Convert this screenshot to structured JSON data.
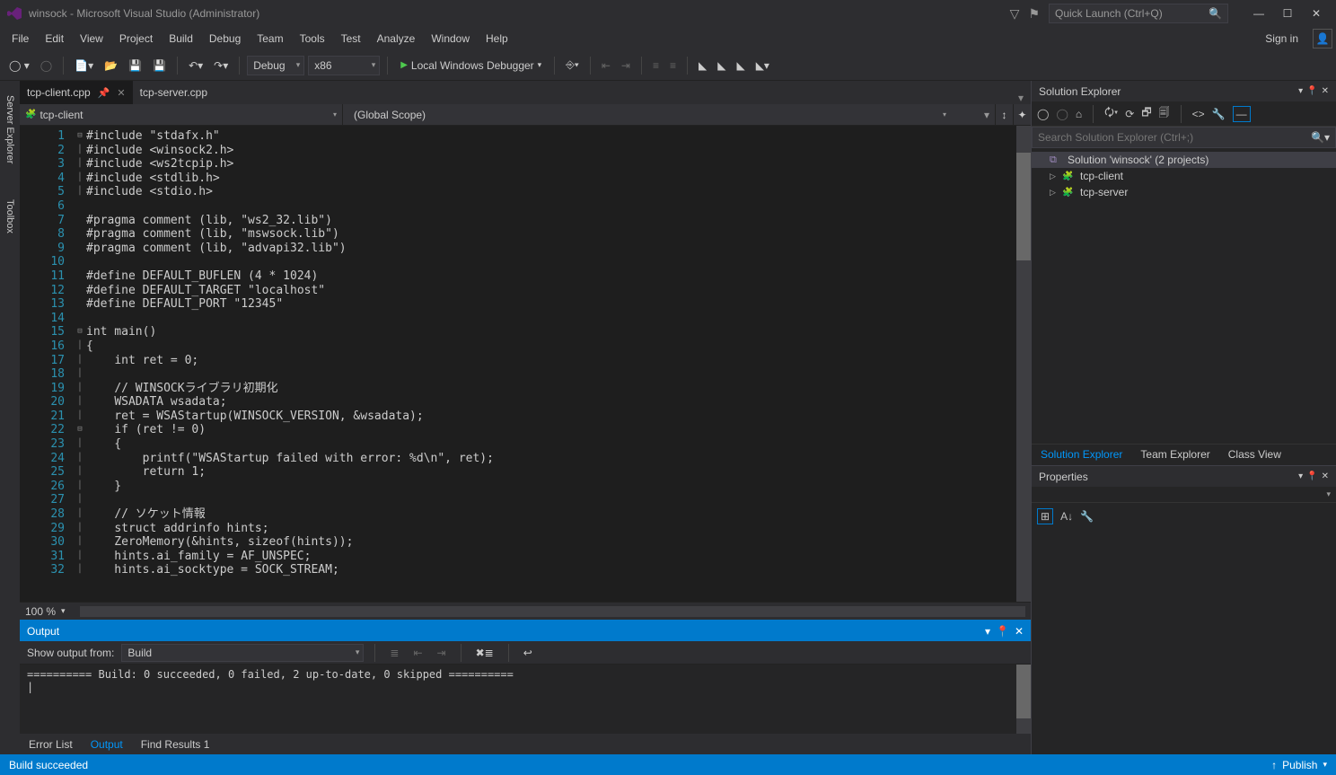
{
  "titlebar": {
    "app_logo_color": "#68217a",
    "title": "winsock - Microsoft Visual Studio  (Administrator)",
    "quick_launch_placeholder": "Quick Launch (Ctrl+Q)"
  },
  "menu": {
    "items": [
      "File",
      "Edit",
      "View",
      "Project",
      "Build",
      "Debug",
      "Team",
      "Tools",
      "Test",
      "Analyze",
      "Window",
      "Help"
    ],
    "signin": "Sign in"
  },
  "toolbar": {
    "config": "Debug",
    "platform": "x86",
    "debugger": "Local Windows Debugger"
  },
  "left_sidebar": {
    "tabs": [
      "Server Explorer",
      "Toolbox"
    ]
  },
  "tabs": [
    {
      "label": "tcp-client.cpp",
      "active": true,
      "pinned": true
    },
    {
      "label": "tcp-server.cpp",
      "active": false,
      "pinned": false
    }
  ],
  "nav": {
    "left_icon": "cpp",
    "left": "tcp-client",
    "right": "(Global Scope)"
  },
  "code": {
    "lines": [
      {
        "n": 1,
        "fold": "⊟",
        "tokens": [
          {
            "t": "#include ",
            "c": "mac"
          },
          {
            "t": "\"stdafx.h\"",
            "c": "str"
          }
        ],
        "bar": true
      },
      {
        "n": 2,
        "tokens": [
          {
            "t": "#include ",
            "c": "mac"
          },
          {
            "t": "<winsock2.h>",
            "c": "str"
          }
        ],
        "bar": true
      },
      {
        "n": 3,
        "tokens": [
          {
            "t": "#include ",
            "c": "mac"
          },
          {
            "t": "<ws2tcpip.h>",
            "c": "str"
          }
        ],
        "bar": true
      },
      {
        "n": 4,
        "tokens": [
          {
            "t": "#include ",
            "c": "mac"
          },
          {
            "t": "<stdlib.h>",
            "c": "str"
          }
        ],
        "bar": true
      },
      {
        "n": 5,
        "tokens": [
          {
            "t": "#include ",
            "c": "mac"
          },
          {
            "t": "<stdio.h>",
            "c": "str"
          }
        ],
        "bar": true
      },
      {
        "n": 6,
        "tokens": []
      },
      {
        "n": 7,
        "tokens": [
          {
            "t": "#pragma ",
            "c": "mac"
          },
          {
            "t": "comment ",
            "c": "mac"
          },
          {
            "t": "(lib, ",
            "c": "id"
          },
          {
            "t": "\"ws2_32.lib\"",
            "c": "str"
          },
          {
            "t": ")",
            "c": "id"
          }
        ]
      },
      {
        "n": 8,
        "tokens": [
          {
            "t": "#pragma ",
            "c": "mac"
          },
          {
            "t": "comment ",
            "c": "mac"
          },
          {
            "t": "(lib, ",
            "c": "id"
          },
          {
            "t": "\"mswsock.lib\"",
            "c": "str"
          },
          {
            "t": ")",
            "c": "id"
          }
        ]
      },
      {
        "n": 9,
        "tokens": [
          {
            "t": "#pragma ",
            "c": "mac"
          },
          {
            "t": "comment ",
            "c": "mac"
          },
          {
            "t": "(lib, ",
            "c": "id"
          },
          {
            "t": "\"advapi32.lib\"",
            "c": "str"
          },
          {
            "t": ")",
            "c": "id"
          }
        ]
      },
      {
        "n": 10,
        "tokens": []
      },
      {
        "n": 11,
        "tokens": [
          {
            "t": "#define ",
            "c": "mac"
          },
          {
            "t": "DEFAULT_BUFLEN",
            "c": "def"
          },
          {
            "t": " (",
            "c": "id"
          },
          {
            "t": "4",
            "c": "num"
          },
          {
            "t": " * ",
            "c": "id"
          },
          {
            "t": "1024",
            "c": "num"
          },
          {
            "t": ")",
            "c": "id"
          }
        ]
      },
      {
        "n": 12,
        "tokens": [
          {
            "t": "#define ",
            "c": "mac"
          },
          {
            "t": "DEFAULT_TARGET",
            "c": "def"
          },
          {
            "t": " ",
            "c": "id"
          },
          {
            "t": "\"localhost\"",
            "c": "str"
          }
        ]
      },
      {
        "n": 13,
        "tokens": [
          {
            "t": "#define ",
            "c": "mac"
          },
          {
            "t": "DEFAULT_PORT",
            "c": "def"
          },
          {
            "t": " ",
            "c": "id"
          },
          {
            "t": "\"12345\"",
            "c": "str"
          }
        ]
      },
      {
        "n": 14,
        "tokens": []
      },
      {
        "n": 15,
        "fold": "⊟",
        "tokens": [
          {
            "t": "int",
            "c": "kw"
          },
          {
            "t": " main()",
            "c": "id"
          }
        ]
      },
      {
        "n": 16,
        "tokens": [
          {
            "t": "{",
            "c": "id"
          }
        ],
        "bar": true
      },
      {
        "n": 17,
        "tokens": [
          {
            "t": "    ",
            "c": "id"
          },
          {
            "t": "int",
            "c": "kw"
          },
          {
            "t": " ret = ",
            "c": "id"
          },
          {
            "t": "0",
            "c": "num"
          },
          {
            "t": ";",
            "c": "id"
          }
        ],
        "bar": true
      },
      {
        "n": 18,
        "tokens": [],
        "bar": true
      },
      {
        "n": 19,
        "tokens": [
          {
            "t": "    ",
            "c": "id"
          },
          {
            "t": "// WINSOCKライブラリ初期化",
            "c": "cm"
          }
        ],
        "bar": true
      },
      {
        "n": 20,
        "tokens": [
          {
            "t": "    ",
            "c": "id"
          },
          {
            "t": "WSADATA",
            "c": "def2"
          },
          {
            "t": " wsadata;",
            "c": "id"
          }
        ],
        "bar": true
      },
      {
        "n": 21,
        "tokens": [
          {
            "t": "    ret = WSAStartup(",
            "c": "id"
          },
          {
            "t": "WINSOCK_VERSION",
            "c": "def"
          },
          {
            "t": ", &wsadata);",
            "c": "id"
          }
        ],
        "bar": true
      },
      {
        "n": 22,
        "fold": "⊟",
        "tokens": [
          {
            "t": "    ",
            "c": "id"
          },
          {
            "t": "if",
            "c": "kw"
          },
          {
            "t": " (ret != ",
            "c": "id"
          },
          {
            "t": "0",
            "c": "num"
          },
          {
            "t": ")",
            "c": "id"
          }
        ],
        "bar": true
      },
      {
        "n": 23,
        "tokens": [
          {
            "t": "    {",
            "c": "id"
          }
        ],
        "bar": true
      },
      {
        "n": 24,
        "tokens": [
          {
            "t": "        printf(",
            "c": "id"
          },
          {
            "t": "\"WSAStartup failed with error: %d\\n\"",
            "c": "str"
          },
          {
            "t": ", ret);",
            "c": "id"
          }
        ],
        "bar": true
      },
      {
        "n": 25,
        "tokens": [
          {
            "t": "        ",
            "c": "id"
          },
          {
            "t": "return",
            "c": "kw"
          },
          {
            "t": " ",
            "c": "id"
          },
          {
            "t": "1",
            "c": "num"
          },
          {
            "t": ";",
            "c": "id"
          }
        ],
        "bar": true
      },
      {
        "n": 26,
        "tokens": [
          {
            "t": "    }",
            "c": "id"
          }
        ],
        "bar": true
      },
      {
        "n": 27,
        "tokens": [],
        "bar": true
      },
      {
        "n": 28,
        "tokens": [
          {
            "t": "    ",
            "c": "id"
          },
          {
            "t": "// ソケット情報",
            "c": "cm"
          }
        ],
        "bar": true
      },
      {
        "n": 29,
        "tokens": [
          {
            "t": "    ",
            "c": "id"
          },
          {
            "t": "struct",
            "c": "kw"
          },
          {
            "t": " ",
            "c": "id"
          },
          {
            "t": "addrinfo",
            "c": "ty"
          },
          {
            "t": " hints;",
            "c": "id"
          }
        ],
        "bar": true
      },
      {
        "n": 30,
        "tokens": [
          {
            "t": "    ZeroMemory",
            "c": "def"
          },
          {
            "t": "(&hints, ",
            "c": "id"
          },
          {
            "t": "sizeof",
            "c": "kw"
          },
          {
            "t": "(hints));",
            "c": "id"
          }
        ],
        "bar": true
      },
      {
        "n": 31,
        "tokens": [
          {
            "t": "    hints.ai_family = ",
            "c": "id"
          },
          {
            "t": "AF_UNSPEC",
            "c": "def"
          },
          {
            "t": ";",
            "c": "id"
          }
        ],
        "bar": true
      },
      {
        "n": 32,
        "tokens": [
          {
            "t": "    hints.ai_socktype = ",
            "c": "id"
          },
          {
            "t": "SOCK_STREAM",
            "c": "def"
          },
          {
            "t": ";",
            "c": "id"
          }
        ],
        "bar": true
      }
    ],
    "zoom": "100 %"
  },
  "output": {
    "title": "Output",
    "show_label": "Show output from:",
    "source": "Build",
    "body": "========== Build: 0 succeeded, 0 failed, 2 up-to-date, 0 skipped ==========\n|",
    "tabs": [
      "Error List",
      "Output",
      "Find Results 1"
    ],
    "active_tab": 1
  },
  "solution_explorer": {
    "title": "Solution Explorer",
    "search_placeholder": "Search Solution Explorer (Ctrl+;)",
    "root": "Solution 'winsock' (2 projects)",
    "projects": [
      "tcp-client",
      "tcp-server"
    ],
    "tabs": [
      "Solution Explorer",
      "Team Explorer",
      "Class View"
    ],
    "active_tab": 0
  },
  "properties": {
    "title": "Properties"
  },
  "statusbar": {
    "left": "Build succeeded",
    "publish": "Publish"
  }
}
